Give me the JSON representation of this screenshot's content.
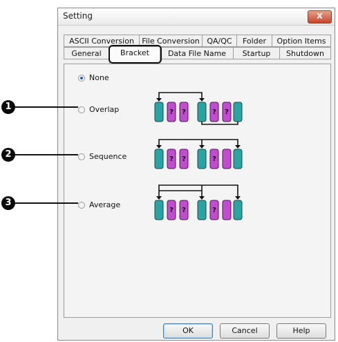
{
  "window": {
    "title": "Setting",
    "close_label": "X"
  },
  "tabs_row1": [
    "ASCII Conversion",
    "File Conversion",
    "QA/QC",
    "Folder",
    "Option Items"
  ],
  "tabs_row2": [
    "General",
    "Bracket",
    "Data File Name",
    "Startup",
    "Shutdown"
  ],
  "active_tab": "Bracket",
  "radio_options": [
    {
      "label": "None",
      "checked": true
    },
    {
      "label": "Overlap",
      "checked": false
    },
    {
      "label": "Sequence",
      "checked": false
    },
    {
      "label": "Average",
      "checked": false
    }
  ],
  "callouts": [
    "1",
    "2",
    "3"
  ],
  "vial_markers": [
    "?",
    "?",
    "?",
    "?",
    "?",
    "?",
    "?",
    "?",
    "?",
    "?"
  ],
  "buttons": {
    "ok": "OK",
    "cancel": "Cancel",
    "help": "Help"
  },
  "colors": {
    "teal_vial": "#2aa3a3",
    "magenta_vial": "#c24ccf",
    "accent": "#2a5db8",
    "close_red": "#c7452a"
  }
}
